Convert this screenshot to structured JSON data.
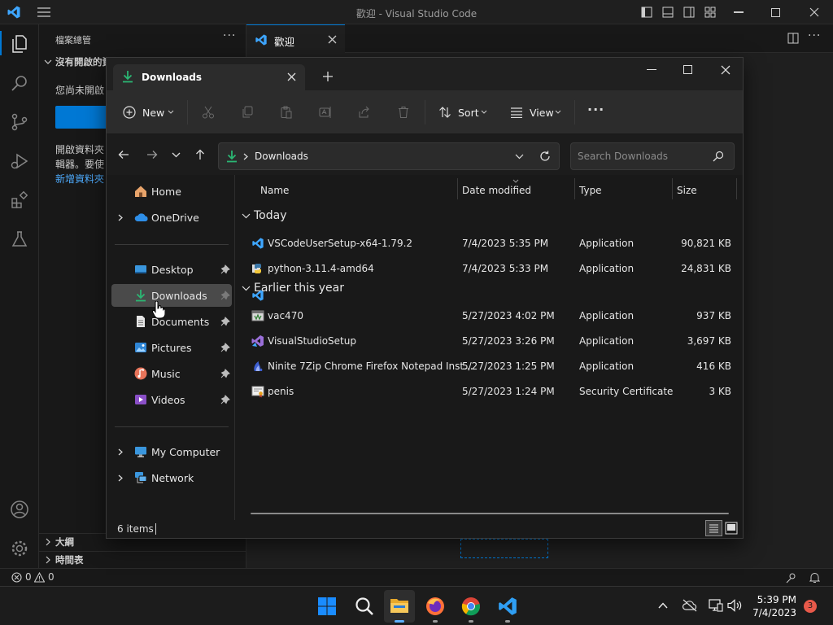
{
  "vscode": {
    "title": "歡迎 - Visual Studio Code",
    "explorer_header": "檔案總管",
    "no_folder_section": "沒有開啟的資料夾",
    "no_folder_text": "您尚未開啟",
    "open_folder_text_1": "開啟資料夾",
    "open_folder_text_2": "輯器。要使",
    "add_folder_link": "新增資料夾",
    "outline_label": "大綱",
    "timeline_label": "時間表",
    "tab_label": "歡迎",
    "status_errors": "0",
    "status_warnings": "0"
  },
  "explorer": {
    "tab_title": "Downloads",
    "new_label": "New",
    "sort_label": "Sort",
    "view_label": "View",
    "breadcrumb": "Downloads",
    "search_placeholder": "Search Downloads",
    "columns": {
      "name": "Name",
      "date": "Date modified",
      "type": "Type",
      "size": "Size"
    },
    "groups": {
      "today": "Today",
      "earlier": "Earlier this year"
    },
    "files": [
      {
        "name": "VSCodeUserSetup-x64-1.79.2",
        "date": "7/4/2023 5:35 PM",
        "type": "Application",
        "size": "90,821 KB"
      },
      {
        "name": "python-3.11.4-amd64",
        "date": "7/4/2023 5:33 PM",
        "type": "Application",
        "size": "24,831 KB"
      },
      {
        "name": "vac470",
        "date": "5/27/2023 4:02 PM",
        "type": "Application",
        "size": "937 KB"
      },
      {
        "name": "VisualStudioSetup",
        "date": "5/27/2023 3:26 PM",
        "type": "Application",
        "size": "3,697 KB"
      },
      {
        "name": "Ninite 7Zip Chrome Firefox Notepad Inst...",
        "date": "5/27/2023 1:25 PM",
        "type": "Application",
        "size": "416 KB"
      },
      {
        "name": "penis",
        "date": "5/27/2023 1:24 PM",
        "type": "Security Certificate",
        "size": "3 KB"
      }
    ],
    "nav": {
      "home": "Home",
      "onedrive": "OneDrive",
      "desktop": "Desktop",
      "downloads": "Downloads",
      "documents": "Documents",
      "pictures": "Pictures",
      "music": "Music",
      "videos": "Videos",
      "my_computer": "My Computer",
      "network": "Network"
    },
    "item_count": "6 items"
  },
  "taskbar": {
    "time": "5:39 PM",
    "date": "7/4/2023",
    "notification_count": "3"
  },
  "colors": {
    "accent": "#0078d4",
    "vscode_blue": "#007acc",
    "download_green": "#2bb673"
  }
}
